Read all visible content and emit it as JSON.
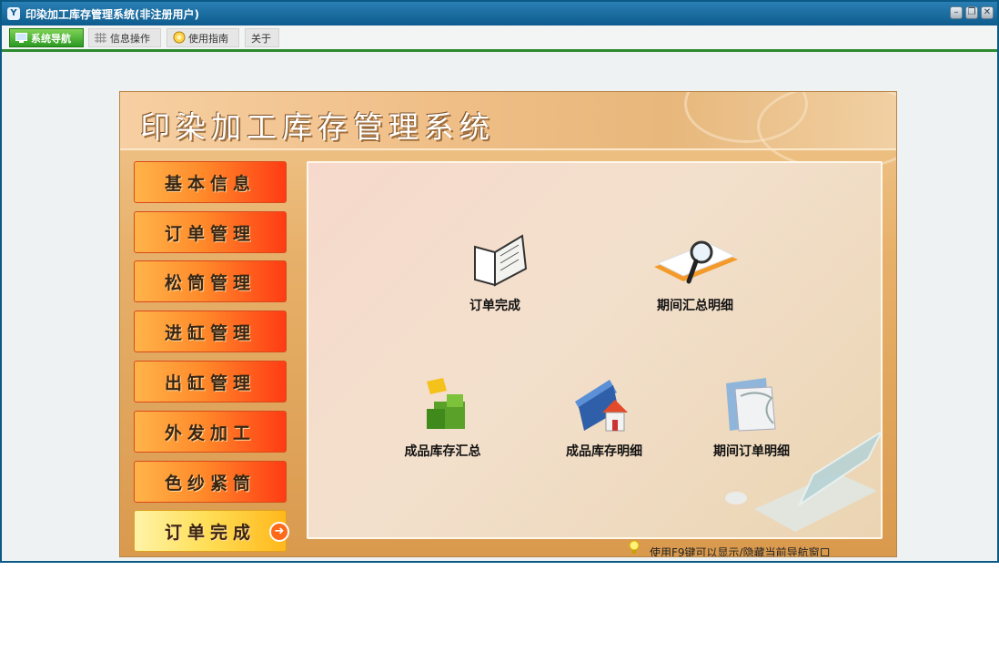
{
  "window": {
    "title": "印染加工库存管理系统(非注册用户)",
    "app_icon_letter": "Y"
  },
  "menubar": {
    "tabs": [
      {
        "label": "系统导航",
        "active": true
      },
      {
        "label": "信息操作",
        "active": false
      },
      {
        "label": "使用指南",
        "active": false
      },
      {
        "label": "关于",
        "active": false
      }
    ]
  },
  "banner": {
    "title": "印染加工库存管理系统"
  },
  "sidebar": {
    "items": [
      {
        "label": "基本信息"
      },
      {
        "label": "订单管理"
      },
      {
        "label": "松筒管理"
      },
      {
        "label": "进缸管理"
      },
      {
        "label": "出缸管理"
      },
      {
        "label": "外发加工"
      },
      {
        "label": "色纱紧筒"
      },
      {
        "label": "订单完成",
        "selected": true
      }
    ]
  },
  "features": [
    {
      "label": "订单完成",
      "icon": "open-book-icon"
    },
    {
      "label": "期间汇总明细",
      "icon": "magnifier-document-icon"
    },
    {
      "label": "成品库存汇总",
      "icon": "green-cubes-icon"
    },
    {
      "label": "成品库存明细",
      "icon": "house-folder-icon"
    },
    {
      "label": "期间订单明细",
      "icon": "folder-scroll-icon"
    }
  ],
  "hint": {
    "text": "使用F9键可以显示/隐藏当前导航窗口"
  },
  "colors": {
    "titlebar": "#0e5c8e",
    "menu_accent": "#2c8a2f",
    "nav_button": "#ff5a1e",
    "nav_selected": "#ffd84a"
  }
}
